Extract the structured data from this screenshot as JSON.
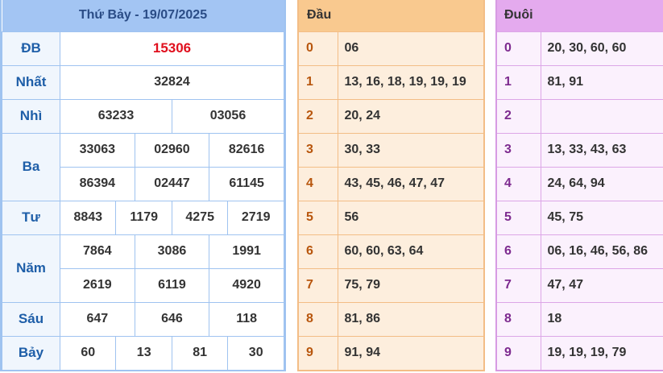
{
  "results": {
    "header": "Thứ Bảy - 19/07/2025",
    "db": {
      "label": "ĐB",
      "value": "15306",
      "color": "#e0101e"
    },
    "nhat": {
      "label": "Nhất",
      "value": "32824"
    },
    "nhi": {
      "label": "Nhì",
      "values": [
        "63233",
        "03056"
      ]
    },
    "ba": {
      "label": "Ba",
      "values": [
        "33063",
        "02960",
        "82616",
        "86394",
        "02447",
        "61145"
      ]
    },
    "tu": {
      "label": "Tư",
      "values": [
        "8843",
        "1179",
        "4275",
        "2719"
      ]
    },
    "nam": {
      "label": "Năm",
      "values": [
        "7864",
        "3086",
        "1991",
        "2619",
        "6119",
        "4920"
      ]
    },
    "sau": {
      "label": "Sáu",
      "values": [
        "647",
        "646",
        "118"
      ]
    },
    "bay": {
      "label": "Bảy",
      "values": [
        "60",
        "13",
        "81",
        "30"
      ]
    }
  },
  "dau": {
    "header": "Đầu",
    "rows": [
      {
        "k": "0",
        "v": "06"
      },
      {
        "k": "1",
        "v": "13, 16, 18, 19, 19, 19"
      },
      {
        "k": "2",
        "v": "20, 24"
      },
      {
        "k": "3",
        "v": "30, 33"
      },
      {
        "k": "4",
        "v": "43, 45, 46, 47, 47"
      },
      {
        "k": "5",
        "v": "56"
      },
      {
        "k": "6",
        "v": "60, 60, 63, 64"
      },
      {
        "k": "7",
        "v": "75, 79"
      },
      {
        "k": "8",
        "v": "81, 86"
      },
      {
        "k": "9",
        "v": "91, 94"
      }
    ]
  },
  "duoi": {
    "header": "Đuôi",
    "rows": [
      {
        "k": "0",
        "v": "20, 30, 60, 60"
      },
      {
        "k": "1",
        "v": "81, 91"
      },
      {
        "k": "2",
        "v": ""
      },
      {
        "k": "3",
        "v": "13, 33, 43, 63"
      },
      {
        "k": "4",
        "v": "24, 64, 94"
      },
      {
        "k": "5",
        "v": "45, 75"
      },
      {
        "k": "6",
        "v": "06, 16, 46, 56, 86"
      },
      {
        "k": "7",
        "v": "47, 47"
      },
      {
        "k": "8",
        "v": "18"
      },
      {
        "k": "9",
        "v": "19, 19, 19, 79"
      }
    ]
  }
}
